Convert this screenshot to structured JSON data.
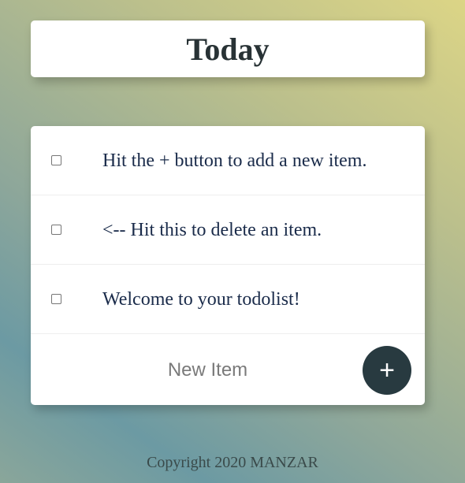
{
  "header": {
    "title": "Today"
  },
  "items": [
    {
      "text": "Hit the + button to add a new item.",
      "checked": false
    },
    {
      "text": "<-- Hit this to delete an item.",
      "checked": false
    },
    {
      "text": "Welcome to your todolist!",
      "checked": false
    }
  ],
  "form": {
    "placeholder": "New Item",
    "add_label": "+"
  },
  "footer": {
    "text": "Copyright 2020 MANZAR"
  },
  "colors": {
    "button": "#283a40",
    "title": "#283235",
    "item_text": "#1a2b4a"
  }
}
